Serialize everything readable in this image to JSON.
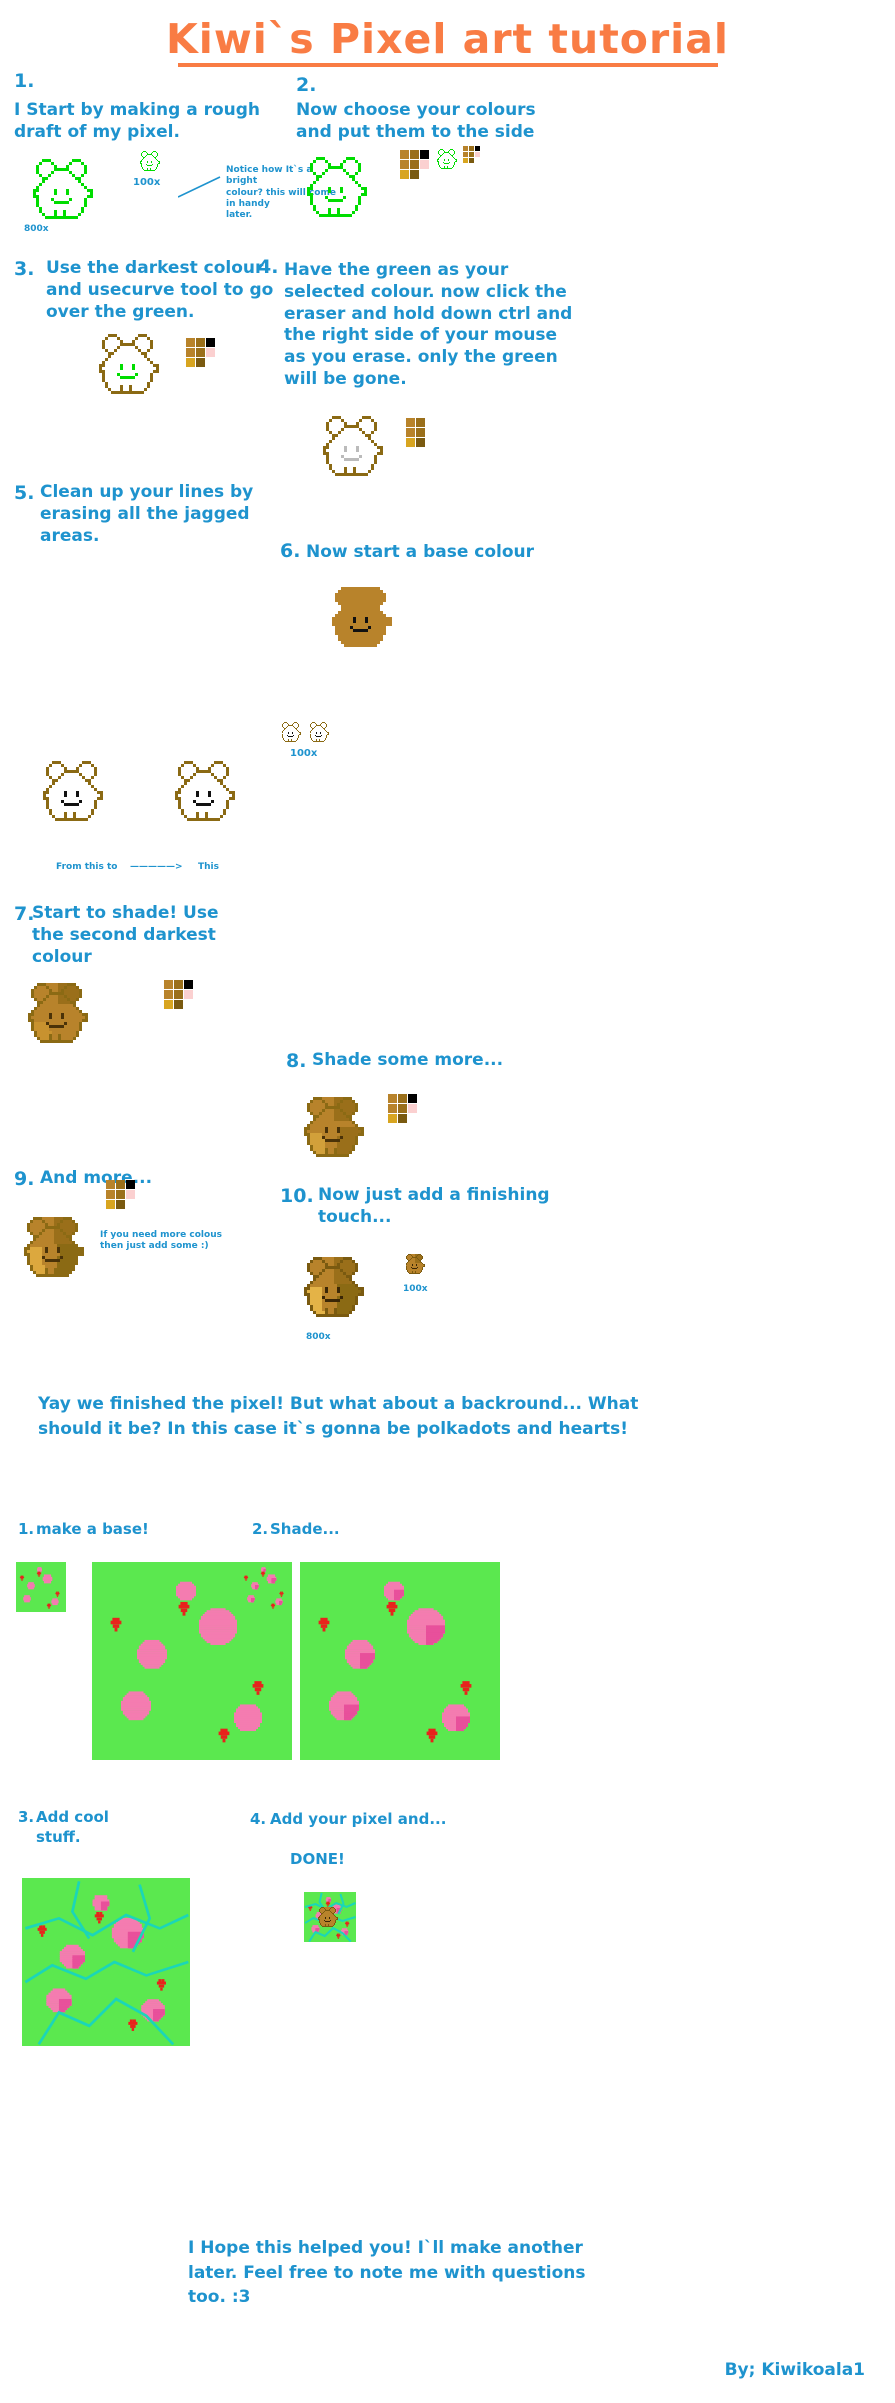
{
  "title": "Kiwi`s Pixel art  tutorial",
  "colors": {
    "title": "#F97C44",
    "text": "#1E93CE",
    "outline_green": "#00DD00",
    "outline_brown": "#8B6A14",
    "base_brown": "#B8832B",
    "bg_green": "#5BE84F",
    "dot_pink": "#F47CB0",
    "heart_red": "#E8231C"
  },
  "steps": [
    {
      "num": "1.",
      "text": "I Start by making a rough\ndraft of my pixel.",
      "zoom_big": "800x",
      "zoom_small": "100x",
      "annotation": "Notice how It`s a bright\ncolour? this will come in handy\nlater."
    },
    {
      "num": "2.",
      "text": "Now choose your colours\nand put them to the side"
    },
    {
      "num": "3.",
      "text": "Use the darkest  colour\nand usecurve tool to go\nover the green."
    },
    {
      "num": "4.",
      "text": "Have the green as your\nselected colour. now click the\neraser and hold down ctrl and\nthe right side of your mouse\nas you erase. only the green\nwill be gone."
    },
    {
      "num": "5.",
      "text": "Clean up your lines by\nerasing all the jagged\nareas.",
      "zoom_small": "100x",
      "caption_from": "From this to",
      "caption_arrow": "—————>",
      "caption_to": "This"
    },
    {
      "num": "6.",
      "text": "Now start a base colour"
    },
    {
      "num": "7.",
      "text": "Start to shade! Use\nthe second darkest\ncolour"
    },
    {
      "num": "8.",
      "text": "Shade some more..."
    },
    {
      "num": "9.",
      "text": "And more...",
      "annotation": "If you need more colous\nthen just add some :)"
    },
    {
      "num": "10.",
      "text": "Now just add a finishing\ntouch...",
      "zoom_big": "800x",
      "zoom_small": "100x"
    }
  ],
  "midnote": "Yay we finished the pixel! But what about a backround... What\nshould it be? In this case it`s gonna be polkadots and hearts!",
  "bg_steps": [
    {
      "num": "1.",
      "text": "make a base!"
    },
    {
      "num": "2.",
      "text": "Shade..."
    },
    {
      "num": "3.",
      "text": "Add cool\nstuff."
    },
    {
      "num": "4.",
      "text": "Add your pixel and...",
      "done": "DONE!"
    }
  ],
  "closing": "I Hope this helped you! I`ll make another\nlater. Feel free to note me with questions\ntoo. :3",
  "credit": "By; Kiwikoala1",
  "palettes": {
    "step2": [
      [
        "#B8832B",
        "#9A6F1A",
        "#000000"
      ],
      [
        "#B8832B",
        "#9A6F1A",
        "#FBD0D0"
      ],
      [
        "#D8A520",
        "#7A5A10",
        ""
      ]
    ],
    "step3": [
      [
        "#B8832B",
        "#9A6F1A",
        "#000000"
      ],
      [
        "#B8832B",
        "#9A6F1A",
        "#FBD0D0"
      ],
      [
        "#D8A520",
        "#7A5A10",
        ""
      ]
    ],
    "step4": [
      [
        "#B8832B",
        "#9A6F1A",
        ""
      ],
      [
        "#B8832B",
        "#9A6F1A",
        ""
      ],
      [
        "#D8A520",
        "#7A5A10",
        ""
      ]
    ],
    "step7": [
      [
        "#B8832B",
        "#9A6F1A",
        "#000000"
      ],
      [
        "#B8832B",
        "#9A6F1A",
        "#FBD0D0"
      ],
      [
        "#D8A520",
        "#7A5A10",
        ""
      ]
    ],
    "step8": [
      [
        "#B8832B",
        "#9A6F1A",
        "#000000"
      ],
      [
        "#B8832B",
        "#9A6F1A",
        "#FBD0D0"
      ],
      [
        "#D8A520",
        "#7A5A10",
        ""
      ]
    ],
    "step9": [
      [
        "#B8832B",
        "#9A6F1A",
        "#000000"
      ],
      [
        "#B8832B",
        "#9A6F1A",
        "#FBD0D0"
      ],
      [
        "#D8A520",
        "#7A5A10",
        ""
      ]
    ]
  }
}
